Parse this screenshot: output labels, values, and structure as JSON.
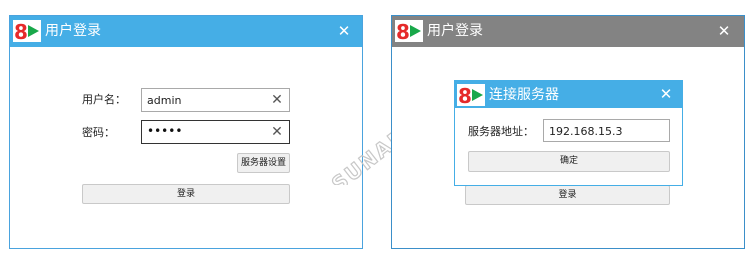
{
  "colors": {
    "titlebar_active": "#45aee6",
    "titlebar_inactive": "#838383",
    "window_border": "#4aa3de",
    "logo_red": "#e52a2a",
    "logo_green": "#19a84a"
  },
  "icons": {
    "logo": "brand-logo-icon",
    "close": "close-icon",
    "clear": "clear-x-icon"
  },
  "login_window": {
    "title": "用户登录",
    "close_glyph": "✕",
    "username_label": "用户名：",
    "username_value": "admin",
    "password_label": "密码：",
    "password_value": "•••••",
    "clear_glyph": "✕",
    "server_settings_button": "服务器设置",
    "login_button": "登录"
  },
  "login_window_background": {
    "title": "用户登录",
    "close_glyph": "✕",
    "login_button": "登录"
  },
  "server_dialog": {
    "title": "连接服务器",
    "close_glyph": "✕",
    "address_label": "服务器地址：",
    "address_value": "192.168.15.3",
    "confirm_button": "确定"
  },
  "watermark": {
    "text": "SUNAM 讯鹏"
  }
}
